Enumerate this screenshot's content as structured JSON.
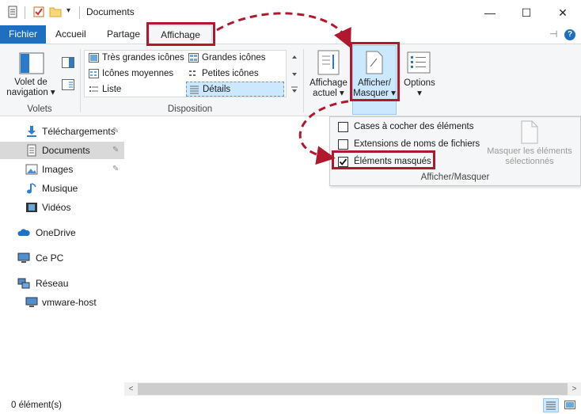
{
  "window": {
    "title": "Documents",
    "controls": {
      "minimize": "—",
      "maximize": "☐",
      "close": "✕"
    }
  },
  "quick_access": {
    "chevron": "▾"
  },
  "tabs": {
    "file": "Fichier",
    "home": "Accueil",
    "share": "Partage",
    "view": "Affichage",
    "pin": "⊣",
    "help": "?"
  },
  "ribbon": {
    "panes_group": {
      "nav_pane_button": [
        "Volet de",
        "navigation ▾"
      ],
      "label": "Volets"
    },
    "layout_group": {
      "items": [
        "Très grandes icônes",
        "Grandes icônes",
        "Icônes moyennes",
        "Petites icônes",
        "Liste",
        "Détails"
      ],
      "label": "Disposition"
    },
    "current_view_button": [
      "Affichage",
      "actuel ▾"
    ],
    "show_hide_button": [
      "Afficher/",
      "Masquer ▾"
    ],
    "options_button": [
      "Options",
      "▾"
    ]
  },
  "show_hide_panel": {
    "checkboxes": [
      {
        "label": "Cases à cocher des éléments",
        "checked": false
      },
      {
        "label": "Extensions de noms de fichiers",
        "checked": false
      },
      {
        "label": "Éléments masqués",
        "checked": true
      }
    ],
    "hide_selected": [
      "Masquer les éléments",
      "sélectionnés"
    ],
    "label": "Afficher/Masquer"
  },
  "nav": {
    "items": [
      {
        "label": "Téléchargements",
        "icon": "download-icon",
        "pinned": true
      },
      {
        "label": "Documents",
        "icon": "document-icon",
        "pinned": true,
        "selected": true
      },
      {
        "label": "Images",
        "icon": "picture-icon",
        "pinned": true
      },
      {
        "label": "Musique",
        "icon": "music-icon"
      },
      {
        "label": "Vidéos",
        "icon": "video-icon"
      },
      {
        "label": "OneDrive",
        "icon": "cloud-icon"
      },
      {
        "label": "Ce PC",
        "icon": "computer-icon"
      },
      {
        "label": "Réseau",
        "icon": "network-icon"
      },
      {
        "label": "vmware-host",
        "icon": "monitor-icon"
      }
    ]
  },
  "status": {
    "count": "0 élément(s)"
  },
  "colors": {
    "accent": "#1e6fc0",
    "annotation": "#b0182d",
    "ribbon_bg": "#f5f6f7",
    "selection": "#cce8ff"
  }
}
